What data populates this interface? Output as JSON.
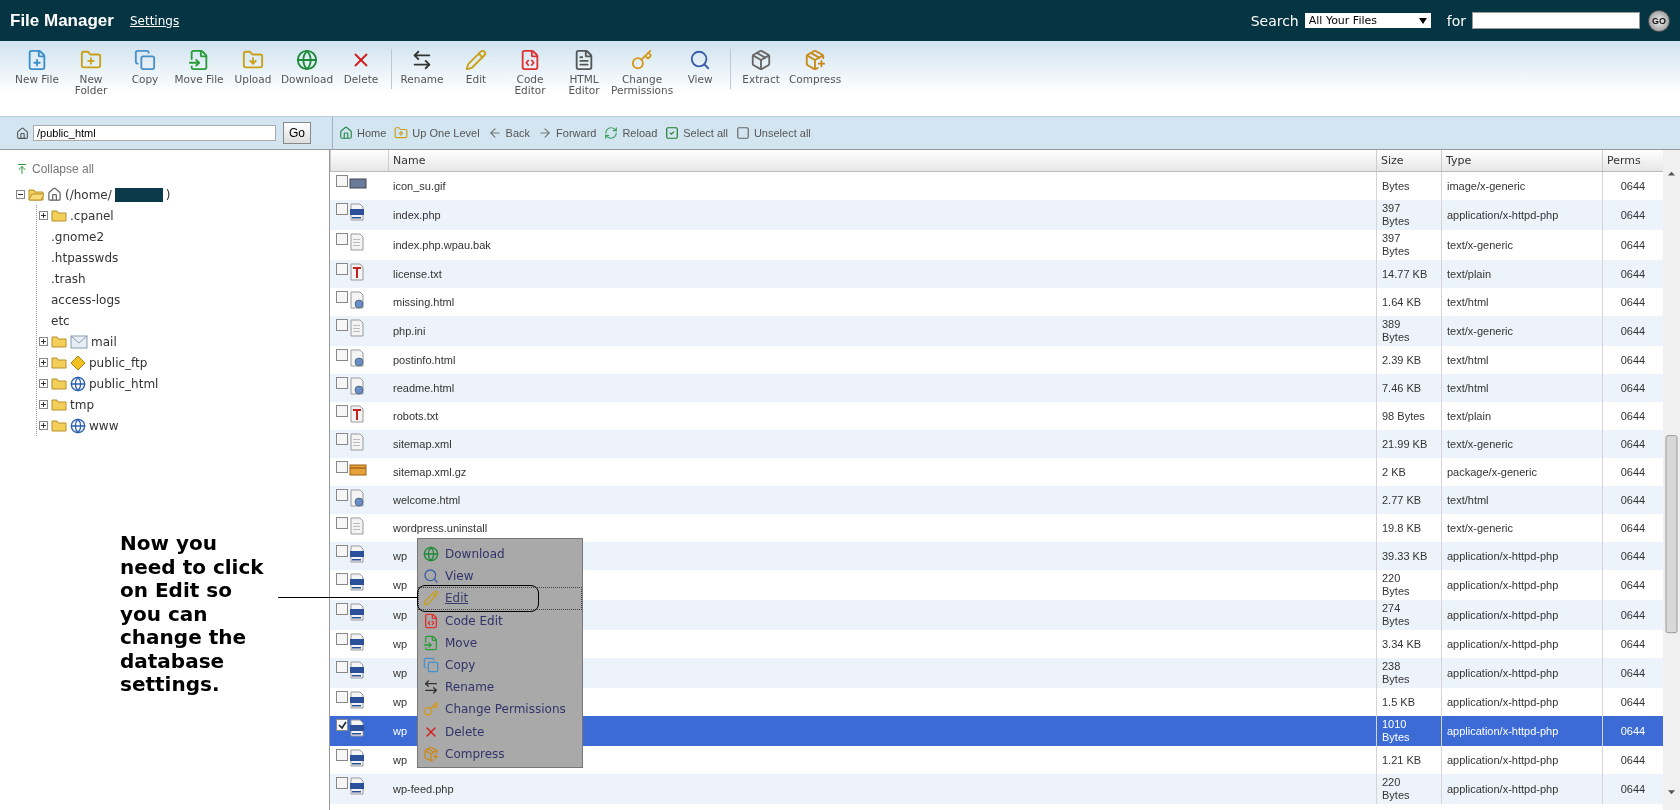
{
  "header": {
    "title": "File Manager",
    "settings_link": "Settings",
    "search_label": "Search",
    "scope": "All Your Files",
    "for_label": "for",
    "go_button": "GO"
  },
  "toolbar": {
    "groups": [
      [
        {
          "kind": "new-file",
          "label": "New File"
        },
        {
          "kind": "new-folder",
          "label": "New Folder"
        },
        {
          "kind": "copy",
          "label": "Copy"
        },
        {
          "kind": "move",
          "label": "Move File"
        },
        {
          "kind": "upload",
          "label": "Upload"
        },
        {
          "kind": "download",
          "label": "Download"
        },
        {
          "kind": "delete",
          "label": "Delete"
        }
      ],
      [
        {
          "kind": "rename",
          "label": "Rename"
        },
        {
          "kind": "edit",
          "label": "Edit"
        },
        {
          "kind": "code",
          "label": "Code Editor"
        },
        {
          "kind": "html",
          "label": "HTML Editor"
        },
        {
          "kind": "permissions",
          "label": "Change Permissions"
        },
        {
          "kind": "view",
          "label": "View"
        }
      ],
      [
        {
          "kind": "extract",
          "label": "Extract"
        },
        {
          "kind": "compress",
          "label": "Compress"
        }
      ]
    ]
  },
  "path": {
    "value": "/public_html",
    "go_button": "Go"
  },
  "nav": [
    {
      "kind": "home",
      "label": "Home"
    },
    {
      "kind": "up",
      "label": "Up One Level"
    },
    {
      "kind": "back",
      "label": "Back"
    },
    {
      "kind": "forward",
      "label": "Forward"
    },
    {
      "kind": "reload",
      "label": "Reload"
    },
    {
      "kind": "select",
      "label": "Select all"
    },
    {
      "kind": "unselect",
      "label": "Unselect all"
    }
  ],
  "tree": {
    "collapse_all": "Collapse all",
    "root": {
      "label": "(/home/",
      "redacted": true,
      "suffix": ")",
      "expanded": true,
      "children": [
        {
          "kind": "folder",
          "label": ".cpanel",
          "expanded": false
        },
        {
          "kind": "plain",
          "label": ".gnome2"
        },
        {
          "kind": "plain",
          "label": ".htpasswds"
        },
        {
          "kind": "plain",
          "label": ".trash"
        },
        {
          "kind": "plain",
          "label": "access-logs"
        },
        {
          "kind": "plain",
          "label": "etc"
        },
        {
          "kind": "mail",
          "label": "mail",
          "expanded": false
        },
        {
          "kind": "ftp",
          "label": "public_ftp",
          "expanded": false
        },
        {
          "kind": "web",
          "label": "public_html",
          "expanded": false
        },
        {
          "kind": "folder",
          "label": "tmp",
          "expanded": false
        },
        {
          "kind": "web",
          "label": "www",
          "expanded": false
        }
      ]
    }
  },
  "table": {
    "columns": [
      "Name",
      "Size",
      "Type",
      "Perms"
    ],
    "rows": [
      {
        "kind": "image",
        "name": "icon_su.gif",
        "size": "Bytes",
        "type": "image/x-generic",
        "perms": "0644",
        "selected": false
      },
      {
        "kind": "php",
        "name": "index.php",
        "size": "397 Bytes",
        "type": "application/x-httpd-php",
        "perms": "0644",
        "selected": false
      },
      {
        "kind": "generic",
        "name": "index.php.wpau.bak",
        "size": "397 Bytes",
        "type": "text/x-generic",
        "perms": "0644",
        "selected": false
      },
      {
        "kind": "text",
        "name": "license.txt",
        "size": "14.77 KB",
        "type": "text/plain",
        "perms": "0644",
        "selected": false
      },
      {
        "kind": "html",
        "name": "missing.html",
        "size": "1.64 KB",
        "type": "text/html",
        "perms": "0644",
        "selected": false
      },
      {
        "kind": "generic",
        "name": "php.ini",
        "size": "389 Bytes",
        "type": "text/x-generic",
        "perms": "0644",
        "selected": false
      },
      {
        "kind": "html",
        "name": "postinfo.html",
        "size": "2.39 KB",
        "type": "text/html",
        "perms": "0644",
        "selected": false
      },
      {
        "kind": "html",
        "name": "readme.html",
        "size": "7.46 KB",
        "type": "text/html",
        "perms": "0644",
        "selected": false
      },
      {
        "kind": "text",
        "name": "robots.txt",
        "size": "98 Bytes",
        "type": "text/plain",
        "perms": "0644",
        "selected": false
      },
      {
        "kind": "generic",
        "name": "sitemap.xml",
        "size": "21.99 KB",
        "type": "text/x-generic",
        "perms": "0644",
        "selected": false
      },
      {
        "kind": "package",
        "name": "sitemap.xml.gz",
        "size": "2 KB",
        "type": "package/x-generic",
        "perms": "0644",
        "selected": false
      },
      {
        "kind": "html",
        "name": "welcome.html",
        "size": "2.77 KB",
        "type": "text/html",
        "perms": "0644",
        "selected": false
      },
      {
        "kind": "generic",
        "name": "wordpress.uninstall",
        "size": "19.8 KB",
        "type": "text/x-generic",
        "perms": "0644",
        "selected": false
      },
      {
        "kind": "php",
        "name": "wp",
        "size": "39.33 KB",
        "type": "application/x-httpd-php",
        "perms": "0644",
        "selected": false
      },
      {
        "kind": "php",
        "name": "wp",
        "size": "220 Bytes",
        "type": "application/x-httpd-php",
        "perms": "0644",
        "selected": false
      },
      {
        "kind": "php",
        "name": "wp",
        "size": "274 Bytes",
        "type": "application/x-httpd-php",
        "perms": "0644",
        "selected": false
      },
      {
        "kind": "php",
        "name": "wp",
        "size": "3.34 KB",
        "type": "application/x-httpd-php",
        "perms": "0644",
        "selected": false
      },
      {
        "kind": "php",
        "name": "wp",
        "size": "238 Bytes",
        "type": "application/x-httpd-php",
        "perms": "0644",
        "selected": false
      },
      {
        "kind": "php",
        "name": "wp",
        "size": "1.5 KB",
        "type": "application/x-httpd-php",
        "perms": "0644",
        "selected": false
      },
      {
        "kind": "php",
        "name": "wp",
        "size": "1010 Bytes",
        "type": "application/x-httpd-php",
        "perms": "0644",
        "selected": true
      },
      {
        "kind": "php",
        "name": "wp",
        "size": "1.21 KB",
        "type": "application/x-httpd-php",
        "perms": "0644",
        "selected": false
      },
      {
        "kind": "php",
        "name": "wp-feed.php",
        "size": "220 Bytes",
        "type": "application/x-httpd-php",
        "perms": "0644",
        "selected": false
      }
    ]
  },
  "context_menu": [
    {
      "kind": "download",
      "label": "Download",
      "selected": false
    },
    {
      "kind": "view",
      "label": "View",
      "selected": false
    },
    {
      "kind": "edit",
      "label": "Edit",
      "selected": true
    },
    {
      "kind": "code",
      "label": "Code Edit",
      "selected": false
    },
    {
      "kind": "move",
      "label": "Move",
      "selected": false
    },
    {
      "kind": "copy",
      "label": "Copy",
      "selected": false
    },
    {
      "kind": "rename",
      "label": "Rename",
      "selected": false
    },
    {
      "kind": "permissions",
      "label": "Change Permissions",
      "selected": false
    },
    {
      "kind": "delete",
      "label": "Delete",
      "selected": false
    },
    {
      "kind": "compress",
      "label": "Compress",
      "selected": false
    }
  ],
  "annotation": "Now you\nneed to click\non Edit so\nyou can\nchange the\ndatabase\nsettings."
}
